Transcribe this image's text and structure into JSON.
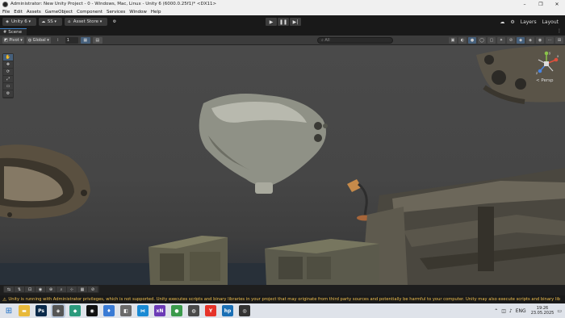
{
  "window": {
    "title": "Administrator: New Unity Project - 0 - Windows, Mac, Linux - Unity 6 (6000.0.25f1)* <DX11>",
    "controls": [
      "–",
      "❐",
      "✕"
    ]
  },
  "menu": [
    "File",
    "Edit",
    "Assets",
    "GameObject",
    "Component",
    "Services",
    "Window",
    "Help"
  ],
  "toolbar": {
    "account_label": "Unity 6",
    "collab_label": "SS",
    "asset_store_label": "Asset Store",
    "play_icons": [
      "▶",
      "❚❚",
      "▶|"
    ],
    "right_icons": [
      "☁",
      "⚙",
      "Layers",
      "Layout"
    ]
  },
  "tabs": [
    {
      "label": "Scene"
    }
  ],
  "scene_toolbar": {
    "pivot_label": "Pivot",
    "global_label": "Global",
    "grid_value": "1",
    "search_placeholder": "All"
  },
  "side_tools": [
    "✋",
    "✥",
    "⟳",
    "⤢",
    "▭",
    "⚙"
  ],
  "gizmo": {
    "axes": [
      "x",
      "y",
      "z"
    ],
    "view_label": "< Persp"
  },
  "bottom_tools_count": 9,
  "status": {
    "message": "Unity is running with Administrator privileges, which is not supported. Unity executes scripts and binary libraries in your project that may originate from third party sources and potentially be harmful to your computer. Unity may also execute scripts and binary lib"
  },
  "taskbar": {
    "apps": [
      {
        "name": "file-explorer",
        "glyph": "▬",
        "color": "#e8b93a"
      },
      {
        "name": "photoshop",
        "glyph": "Ps",
        "color": "#0b2a4a"
      },
      {
        "name": "unity",
        "glyph": "◈",
        "color": "#555555"
      },
      {
        "name": "app-green",
        "glyph": "◆",
        "color": "#2b9a7c"
      },
      {
        "name": "app-black",
        "glyph": "◉",
        "color": "#111111"
      },
      {
        "name": "app-blue",
        "glyph": "♦",
        "color": "#3a7bd5"
      },
      {
        "name": "app-grey",
        "glyph": "◧",
        "color": "#6a6a6a"
      },
      {
        "name": "visual-studio-code",
        "glyph": "⋈",
        "color": "#1a8ad4"
      },
      {
        "name": "app-purple",
        "glyph": "xN",
        "color": "#6c3bb6"
      },
      {
        "name": "chrome",
        "glyph": "●",
        "color": "#3b9a4c"
      },
      {
        "name": "app-dark",
        "glyph": "◍",
        "color": "#4a4a4a"
      },
      {
        "name": "yandex",
        "glyph": "Y",
        "color": "#e6332a"
      },
      {
        "name": "hp",
        "glyph": "hp",
        "color": "#1a6fb5"
      },
      {
        "name": "obs",
        "glyph": "◎",
        "color": "#333333"
      }
    ],
    "language": "ENG",
    "time": "19:26",
    "date": "23.05.2025"
  }
}
